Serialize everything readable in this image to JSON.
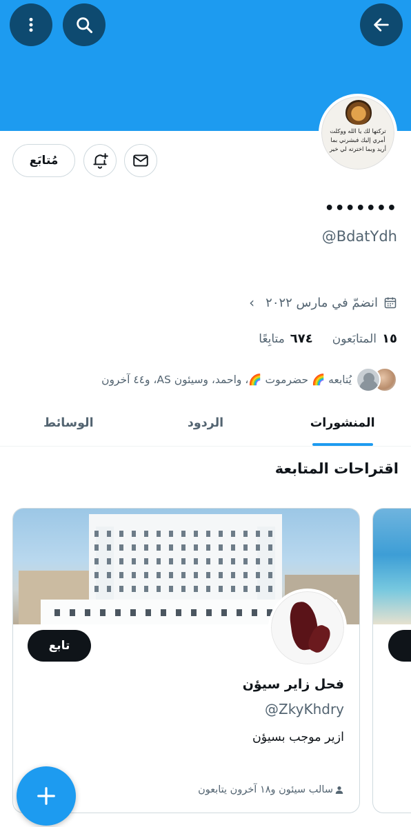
{
  "header": {
    "icons": {
      "more": "more-vertical-icon",
      "search": "search-icon",
      "back": "arrow-left-icon"
    },
    "banner_color": "#1d9bf0"
  },
  "profile": {
    "avatar_text": "تركتها لك يا الله ووكلت أمري إليك فبشرني بما أريد وبما اخترته لي خير",
    "name": "•••••••",
    "handle": "@BdatYdh",
    "joined": "انضمّ في مارس ٢٠٢٢",
    "followers_count": "١٥",
    "followers_label": "المتابَعون",
    "following_count": "٦٧٤",
    "following_label": "متابِعًا",
    "followed_by": "يُتابعه 🌈 حضرموت 🌈، واحمد، وسيئون AS، و٤٤ آخرون"
  },
  "actions": {
    "following_label": "مُتابَع",
    "bell_icon": "bell-plus-icon",
    "mail_icon": "mail-icon"
  },
  "tabs": [
    {
      "label": "المنشورات",
      "active": true
    },
    {
      "label": "الردود",
      "active": false
    },
    {
      "label": "الوسائط",
      "active": false
    }
  ],
  "suggestions": {
    "title": "اقتراحات المتابعة",
    "cards": [
      {
        "follow_label": "تابع",
        "name": "فحل زاير سيؤن",
        "handle": "@ZkyKhdry",
        "bio": "ازير موجب  بسيؤن",
        "followed_by": "سالب سيئون و١٨ آخرون يتابعون"
      }
    ]
  },
  "colors": {
    "accent": "#1d9bf0",
    "dark_button": "#0e4a70",
    "text": "#0f1419",
    "muted": "#536471"
  }
}
